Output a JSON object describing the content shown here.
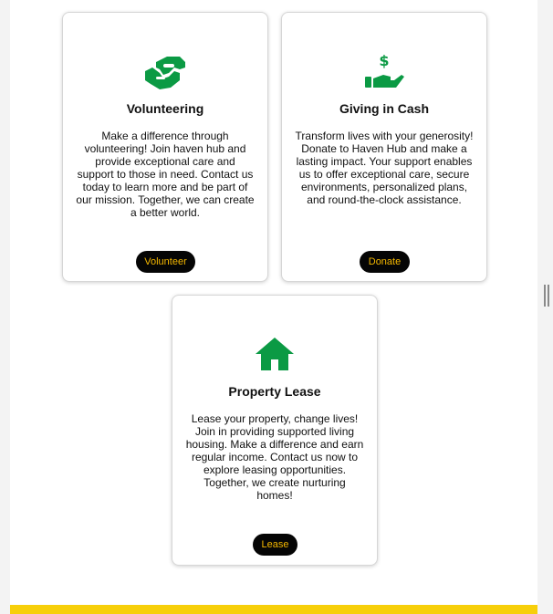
{
  "colors": {
    "icon_green": "#0b9a44",
    "button_bg": "#050505",
    "button_text": "#f5b800",
    "footer_yellow": "#f7cf0a"
  },
  "cards": [
    {
      "icon": "handshake-icon",
      "title": "Volunteering",
      "description": "Make a difference through volunteering! Join haven hub and provide exceptional care and support to those in need. Contact us today to learn more and be part of our mission. Together, we can create a better world.",
      "button_label": "Volunteer"
    },
    {
      "icon": "hand-dollar-icon",
      "title": "Giving in Cash",
      "description": "Transform lives with your generosity! Donate to Haven Hub and make a lasting impact. Your support enables us to offer exceptional care, secure environments, personalized plans, and round-the-clock assistance.",
      "button_label": "Donate"
    },
    {
      "icon": "house-icon",
      "title": "Property Lease",
      "description": "Lease your property, change lives! Join in providing supported living housing. Make a difference and earn regular income. Contact us now to explore leasing opportunities. Together, we create nurturing homes!",
      "button_label": "Lease"
    }
  ]
}
